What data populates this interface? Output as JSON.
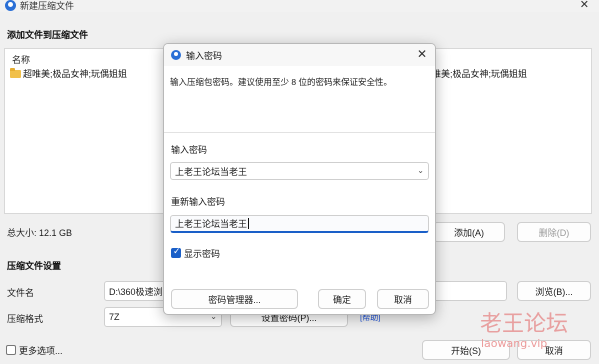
{
  "main_window": {
    "title": "新建压缩文件",
    "section_add": "添加文件到压缩文件",
    "column_name": "名称",
    "file_item": "超唯美;极品女神;玩偶姐姐",
    "file_item_right_partial": "唯美;极品女神;玩偶姐姐",
    "total_size": "总大小: 12.1 GB",
    "add_button": "添加(A)",
    "delete_button": "删除(D)",
    "section_settings": "压缩文件设置",
    "filename_label": "文件名",
    "filename_value": "D:\\360极速浏",
    "browse_button": "浏览(B)...",
    "format_label": "压缩格式",
    "format_value": "7Z",
    "set_password_button": "设置密码(P)...",
    "help_link": "[帮助]",
    "more_options": "更多选项...",
    "start_button": "开始(S)",
    "cancel_button": "取消"
  },
  "password_dialog": {
    "title": "输入密码",
    "description": "输入压缩包密码。建议使用至少 8 位的密码来保证安全性。",
    "password_label": "输入密码",
    "password_value": "上老王论坛当老王",
    "confirm_label": "重新输入密码",
    "confirm_value": "上老王论坛当老王",
    "show_password_label": "显示密码",
    "show_password_checked": true,
    "manager_button": "密码管理器...",
    "ok_button": "确定",
    "cancel_button": "取消"
  },
  "watermark": {
    "text_cn": "老王论坛",
    "text_en": "laowang.vip"
  },
  "colors": {
    "accent": "#1a5fc8",
    "window_bg": "#f0f0f0",
    "watermark": "#e8a0a0"
  }
}
